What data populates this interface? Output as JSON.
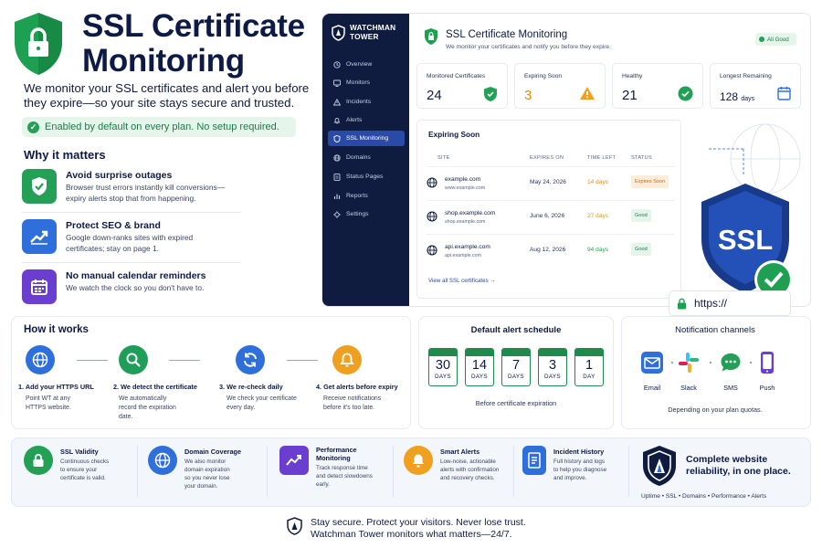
{
  "hero": {
    "title_line1": "SSL Certificate",
    "title_line2": "Monitoring",
    "subtitle_line1": "We monitor your SSL certificates and alert you before",
    "subtitle_line2": "they expire—so your site stays secure and trusted.",
    "enabled_pill": "Enabled by default on every plan. No setup required."
  },
  "why": {
    "title": "Why it matters",
    "items": [
      {
        "title": "Avoid surprise outages",
        "desc1": "Browser trust errors instantly kill conversions—",
        "desc2": "expiry alerts stop that from happening.",
        "icon": "shield-check-icon",
        "color": "#23a056"
      },
      {
        "title": "Protect SEO & brand",
        "desc1": "Google down-ranks sites with expired",
        "desc2": "certificates; stay on page 1.",
        "icon": "chart-up-icon",
        "color": "#2f6fdc"
      },
      {
        "title": "No manual calendar reminders",
        "desc1": "We watch the clock so you don't have to.",
        "desc2": "",
        "icon": "calendar-icon",
        "color": "#6a3fcf"
      }
    ]
  },
  "app": {
    "brand_line1": "WATCHMAN",
    "brand_line2": "TOWER",
    "nav": [
      {
        "label": "Overview",
        "icon": "clock-icon"
      },
      {
        "label": "Monitors",
        "icon": "monitor-icon"
      },
      {
        "label": "Incidents",
        "icon": "warning-icon"
      },
      {
        "label": "Alerts",
        "icon": "bell-icon"
      },
      {
        "label": "SSL Monitoring",
        "icon": "shield-icon",
        "active": true
      },
      {
        "label": "Domains",
        "icon": "globe-icon"
      },
      {
        "label": "Status Pages",
        "icon": "pages-icon"
      },
      {
        "label": "Reports",
        "icon": "reports-icon"
      },
      {
        "label": "Settings",
        "icon": "gear-icon"
      }
    ],
    "title": "SSL Certificate Monitoring",
    "subtitle": "We monitor your certificates and notify you before they expire.",
    "status": "All Good",
    "stats": [
      {
        "label": "Monitored Certificates",
        "value": "24",
        "unit": ""
      },
      {
        "label": "Expiring Soon",
        "value": "3",
        "unit": ""
      },
      {
        "label": "Healthy",
        "value": "21",
        "unit": ""
      },
      {
        "label": "Longest Remaining",
        "value": "128",
        "unit": "days"
      }
    ],
    "panel": {
      "title": "Expiring Soon",
      "columns": [
        "SITE",
        "EXPIRES ON",
        "TIME LEFT",
        "STATUS"
      ],
      "rows": [
        {
          "host": "example.com",
          "url": "www.example.com",
          "expires": "May 24, 2026",
          "left": "14 days",
          "left_color": "#e8890c",
          "status": "Expires Soon",
          "status_bg": "#fdecd9",
          "status_color": "#c96a0a"
        },
        {
          "host": "shop.example.com",
          "url": "shop.example.com",
          "expires": "June 6, 2026",
          "left": "27 days",
          "left_color": "#d6a21a",
          "status": "Good",
          "status_bg": "#e6f5ec",
          "status_color": "#1e7a44"
        },
        {
          "host": "api.example.com",
          "url": "api.example.com",
          "expires": "Aug 12, 2026",
          "left": "94 days",
          "left_color": "#23a056",
          "status": "Good",
          "status_bg": "#e6f5ec",
          "status_color": "#1e7a44"
        }
      ],
      "view_all": "View all SSL certificates →"
    },
    "shield_text": "SSL",
    "https_text": "https://"
  },
  "how": {
    "title": "How it works",
    "steps": [
      {
        "title": "1. Add your HTTPS URL",
        "desc1": "Point WT at any",
        "desc2": "HTTPS website.",
        "desc3": "",
        "color": "#2f6fdc",
        "icon": "globe-icon"
      },
      {
        "title": "2. We detect the certificate",
        "desc1": "We automatically",
        "desc2": "record the expiration",
        "desc3": "date.",
        "color": "#1f9e5a",
        "icon": "search-icon"
      },
      {
        "title": "3. We re-check daily",
        "desc1": "We check your certificate",
        "desc2": "every day.",
        "desc3": "",
        "color": "#2f6fdc",
        "icon": "refresh-icon"
      },
      {
        "title": "4. Get alerts before expiry",
        "desc1": "Receive notifications",
        "desc2": "before it's too late.",
        "desc3": "",
        "color": "#f0a020",
        "icon": "bell-icon"
      }
    ]
  },
  "schedule": {
    "title": "Default alert schedule",
    "days": [
      "30",
      "14",
      "7",
      "3",
      "1"
    ],
    "days_label": "DAYS",
    "day_label": "DAY",
    "footer": "Before certificate expiration"
  },
  "channels": {
    "title": "Notification channels",
    "items": [
      {
        "label": "Email",
        "icon": "email-icon"
      },
      {
        "label": "Slack",
        "icon": "slack-icon"
      },
      {
        "label": "SMS",
        "icon": "sms-icon"
      },
      {
        "label": "Push",
        "icon": "push-icon"
      }
    ],
    "footer": "Depending on your plan quotas."
  },
  "features": [
    {
      "title": "SSL Validity",
      "d1": "Continuous checks",
      "d2": "to ensure your",
      "d3": "certificate is valid.",
      "d4": "",
      "icon": "lock-icon"
    },
    {
      "title": "Domain Coverage",
      "d1": "We also monitor",
      "d2": "domain expiration",
      "d3": "so you never lose",
      "d4": "your domain.",
      "icon": "globe-icon"
    },
    {
      "title": "Performance",
      "title2": "Monitoring",
      "d1": "Track response time",
      "d2": "and detect slowdowns",
      "d3": "early.",
      "d4": "",
      "icon": "performance-icon"
    },
    {
      "title": "Smart Alerts",
      "d1": "Low-noise, actionable",
      "d2": "alerts with confirmation",
      "d3": "and recovery checks.",
      "d4": "",
      "icon": "bell-icon"
    },
    {
      "title": "Incident History",
      "d1": "Full history and logs",
      "d2": "to help you diagnose",
      "d3": "and improve.",
      "d4": "",
      "icon": "history-icon"
    }
  ],
  "reliability": {
    "line1": "Complete website",
    "line2": "reliability, in one place.",
    "footer": "Uptime • SSL • Domains • Performance • Alerts"
  },
  "footer": {
    "line1": "Stay secure. Protect your visitors. Never lose trust.",
    "line2": "Watchman Tower monitors what matters—24/7."
  },
  "colors": {
    "navy": "#0f1c3f",
    "green": "#23a056",
    "blue": "#2f6fdc",
    "orange": "#f0a020"
  }
}
